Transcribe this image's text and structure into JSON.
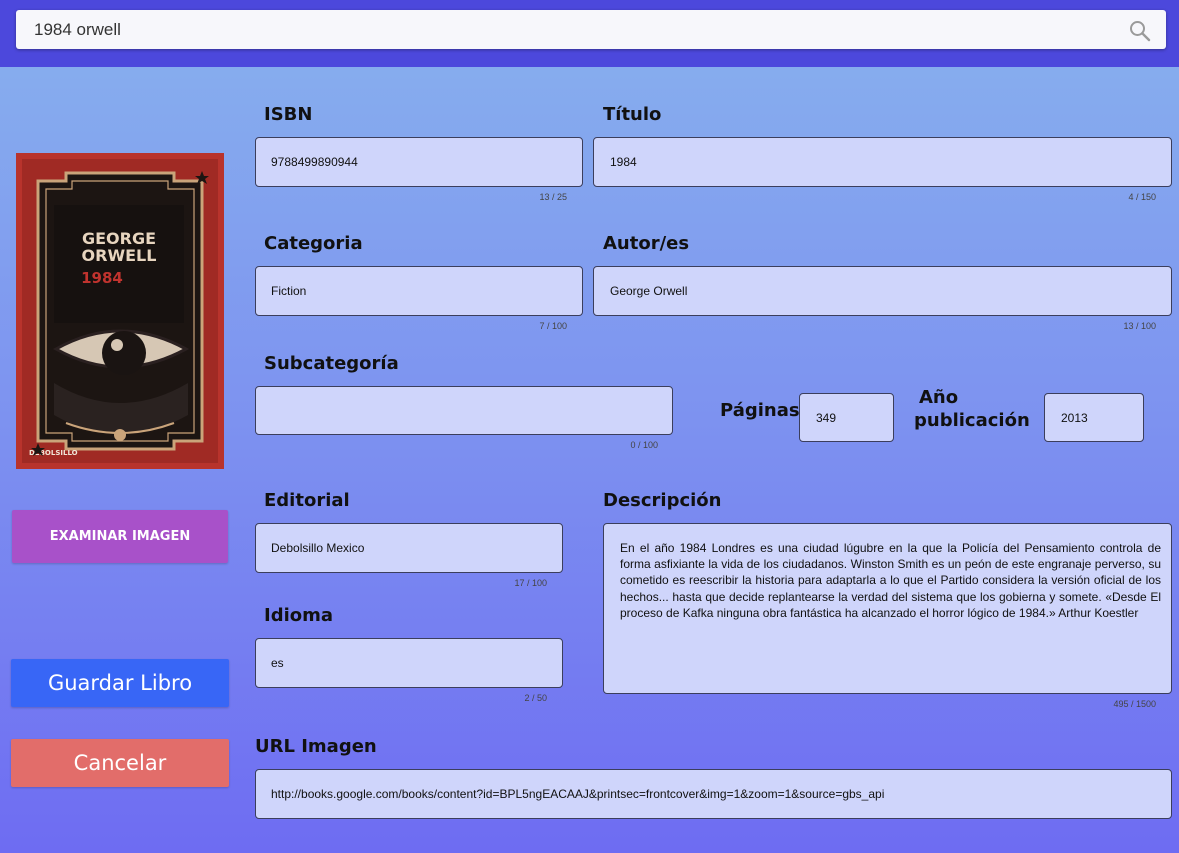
{
  "search": {
    "value": "1984 orwell"
  },
  "buttons": {
    "examine": "EXAMINAR IMAGEN",
    "save": "Guardar Libro",
    "cancel": "Cancelar"
  },
  "cover": {
    "author_line1": "GEORGE",
    "author_line2": "ORWELL",
    "title": "1984",
    "publisher": "DEBOLSILLO"
  },
  "fields": {
    "isbn": {
      "label": "ISBN",
      "value": "9788499890944",
      "counter": "13 / 25"
    },
    "titulo": {
      "label": "Título",
      "value": "1984",
      "counter": "4 / 150"
    },
    "categoria": {
      "label": "Categoria",
      "value": "Fiction",
      "counter": "7 / 100"
    },
    "autor": {
      "label": "Autor/es",
      "value": "George Orwell",
      "counter": "13 / 100"
    },
    "subcategoria": {
      "label": "Subcategoría",
      "value": "",
      "counter": "0 / 100"
    },
    "paginas": {
      "label": "Páginas",
      "value": "349"
    },
    "anio": {
      "label_line1": "Año",
      "label_line2": "publicación",
      "value": "2013"
    },
    "editorial": {
      "label": "Editorial",
      "value": "Debolsillo Mexico",
      "counter": "17 / 100"
    },
    "idioma": {
      "label": "Idioma",
      "value": "es",
      "counter": "2 / 50"
    },
    "descripcion": {
      "label": "Descripción",
      "value": "En el año 1984 Londres es una ciudad lúgubre en la que la Policía del Pensamiento controla de forma asfixiante la vida de los ciudadanos. Winston Smith es un peón de este engranaje perverso, su cometido es reescribir la historia para adaptarla a lo que el Partido considera la versión oficial de los hechos... hasta que decide replantearse la verdad del sistema que los gobierna y somete. «Desde El proceso de Kafka ninguna obra fantástica ha alcanzado el horror lógico de 1984.» Arthur Koestler",
      "counter": "495 / 1500"
    },
    "url": {
      "label": "URL Imagen",
      "value": "http://books.google.com/books/content?id=BPL5ngEACAAJ&printsec=frontcover&img=1&zoom=1&source=gbs_api"
    }
  },
  "colors": {
    "topbar": "#4c48dc",
    "field_bg": "#cfd5fb",
    "examine_button": "#a851c9",
    "save_button": "#3866f6",
    "cancel_button": "#e26d6a"
  }
}
